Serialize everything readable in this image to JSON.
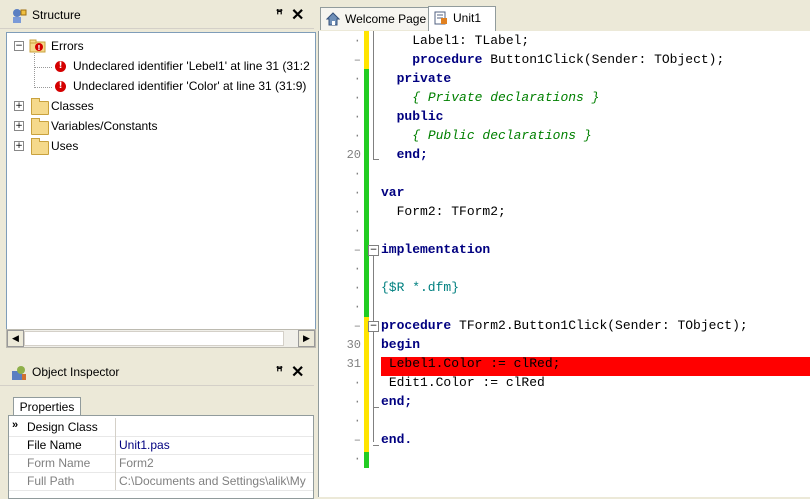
{
  "structure": {
    "title": "Structure",
    "pin_glyph": "ꟸ",
    "close_glyph": "✕",
    "errors_label": "Errors",
    "errors": [
      "Undeclared identifier 'Lebel1' at line 31 (31:2",
      "Undeclared identifier 'Color' at line 31 (31:9)"
    ],
    "nodes": [
      "Classes",
      "Variables/Constants",
      "Uses"
    ]
  },
  "inspector": {
    "title": "Object Inspector",
    "tab": "Properties",
    "rows": [
      {
        "key": "Design Class",
        "value": ""
      },
      {
        "key": "File Name",
        "value": "Unit1.pas"
      },
      {
        "key": "Form Name",
        "value": "Form2"
      },
      {
        "key": "Full Path",
        "value": "C:\\Documents and Settings\\alik\\My"
      }
    ]
  },
  "editor": {
    "tabs": [
      "Welcome Page",
      "Unit1"
    ],
    "line_numbers": {
      "l20": "20",
      "l30": "30",
      "l31": "31"
    },
    "code": {
      "c1": "Label1: TLabel;",
      "c2_kw": "procedure",
      "c2_rest": " Button1Click(Sender: TObject);",
      "c3": "private",
      "c4": "{ Private declarations }",
      "c5": "public",
      "c6": "{ Public declarations }",
      "c7": "end;",
      "c8": "var",
      "c9": "Form2: TForm2;",
      "c10": "implementation",
      "c11": "{$R *.dfm}",
      "c12_kw": "procedure",
      "c12_rest": " TForm2.Button1Click(Sender: TObject);",
      "c13": "begin",
      "c14": "Lebel1.Color := clRed;",
      "c15": "Edit1.Color := clRed",
      "c16": "end;",
      "c17": "end."
    }
  },
  "colors": {
    "error_line": "#ff0000",
    "keyword": "#000080",
    "comment": "#008000",
    "modified_bar": "#ffe400",
    "saved_bar": "#22cc22"
  }
}
